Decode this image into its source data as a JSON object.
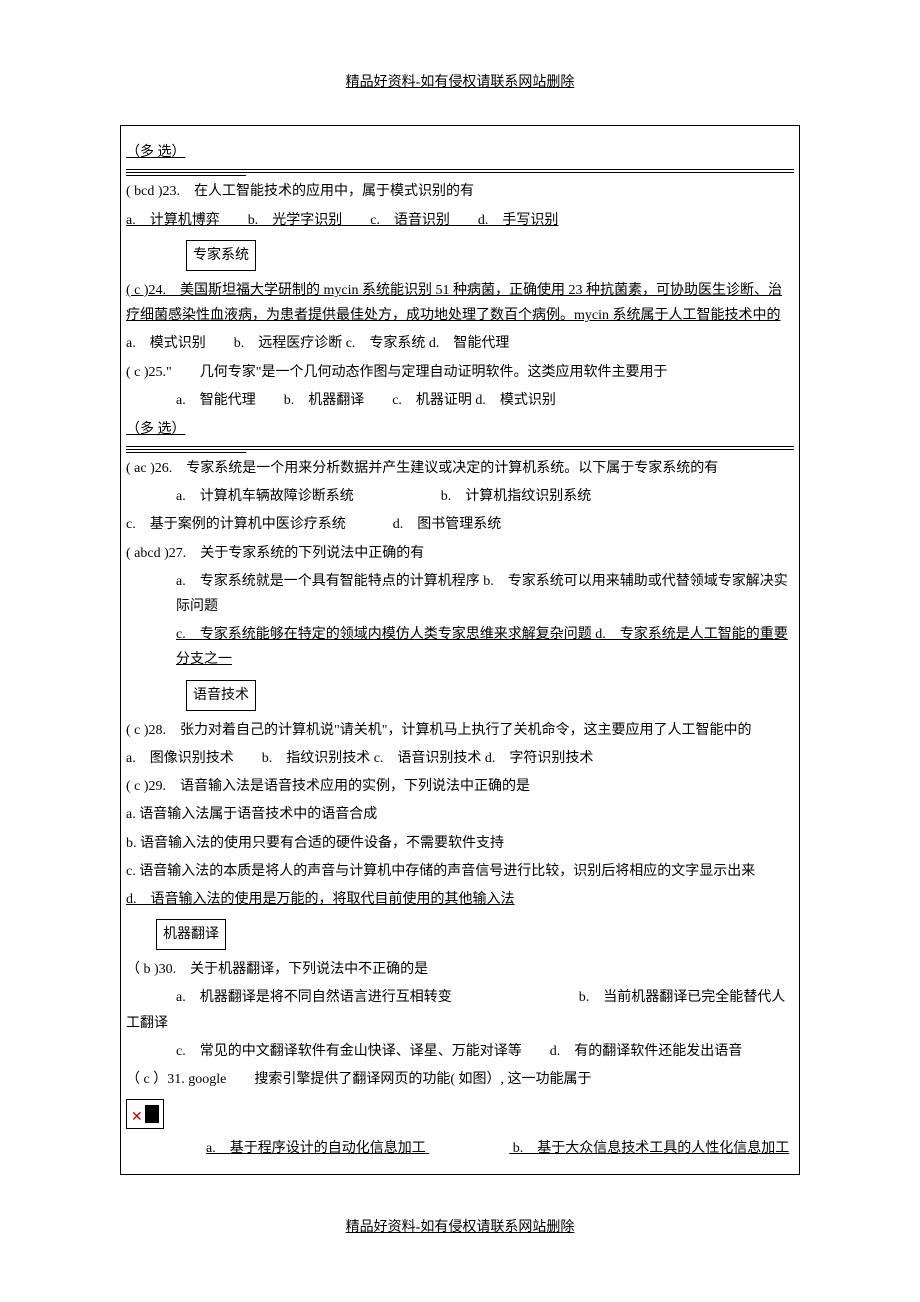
{
  "header": "精品好资料-如有侵权请联系网站删除",
  "footer": "精品好资料-如有侵权请联系网站删除",
  "multi_select_label": "（多\n选）",
  "sections": {
    "expert_system": "专家系统",
    "voice_tech": "语音技术",
    "machine_translation": "机器翻译"
  },
  "q23": {
    "stem": "( bcd )23.　在人工智能技术的应用中，属于模式识别的有",
    "opts": "a.　计算机博弈　　b.　光学字识别　　c.　语音识别　　d.　手写识别"
  },
  "q24": {
    "stem": "( c )24.　美国斯坦福大学研制的 mycin 系统能识别 51 种病菌，正确使用 23 种抗菌素，可协助医生诊断、治疗细菌感染性血液病，为患者提供最佳处方，成功地处理了数百个病例。mycin 系统属于人工智能技术中的",
    "opts": "a.　模式识别　　b.　远程医疗诊断 c.　专家系统 d.　智能代理"
  },
  "q25": {
    "stem": "( c )25.\"　　几何专家\"是一个几何动态作图与定理自动证明软件。这类应用软件主要用于",
    "opts": "a.　智能代理　　b.　机器翻译　　c.　机器证明 d.　模式识别"
  },
  "q26": {
    "stem": "( ac )26.　专家系统是一个用来分析数据并产生建议或决定的计算机系统。以下属于专家系统的有",
    "opt_a": "a.　计算机车辆故障诊断系统",
    "opt_b": "b.　计算机指纹识别系统",
    "opt_c": "c.　基于案例的计算机中医诊疗系统",
    "opt_d": "d.　图书管理系统"
  },
  "q27": {
    "stem": "( abcd )27.　关于专家系统的下列说法中正确的有",
    "opt_ab": "a.　专家系统就是一个具有智能特点的计算机程序 b.　专家系统可以用来辅助或代替领域专家解决实际问题",
    "opt_cd": "c.　专家系统能够在特定的领域内模仿人类专家思维来求解复杂问题 d.　专家系统是人工智能的重要分支之一"
  },
  "q28": {
    "stem": "( c )28.　张力对着自己的计算机说\"请关机\"，计算机马上执行了关机命令，这主要应用了人工智能中的",
    "opts": "a.　图像识别技术　　b.　指纹识别技术 c.　语音识别技术 d.　字符识别技术"
  },
  "q29": {
    "stem": "( c )29.　语音输入法是语音技术应用的实例，下列说法中正确的是",
    "opt_a": "a. 语音输入法属于语音技术中的语音合成",
    "opt_b": "b. 语音输入法的使用只要有合适的硬件设备，不需要软件支持",
    "opt_c": "c. 语音输入法的本质是将人的声音与计算机中存储的声音信号进行比较，识别后将相应的文字显示出来",
    "opt_d": "d.　语音输入法的使用是万能的，将取代目前使用的其他输入法"
  },
  "q30": {
    "stem": "（ b )30.　关于机器翻译，下列说法中不正确的是",
    "opt_a": "a.　机器翻译是将不同自然语言进行互相转变",
    "opt_b": "b.　当前机器翻译已完全能替代人工翻译",
    "opt_cd": "c.　常见的中文翻译软件有金山快译、译星、万能对译等　　d.　有的翻译软件还能发出语音"
  },
  "q31": {
    "stem": "（ c ）31. google　　搜索引擎提供了翻译网页的功能( 如图）, 这一功能属于",
    "opt_a": "a.　基于程序设计的自动化信息加工",
    "opt_b": "b.　基于大众信息技术工具的人性化信息加工"
  }
}
